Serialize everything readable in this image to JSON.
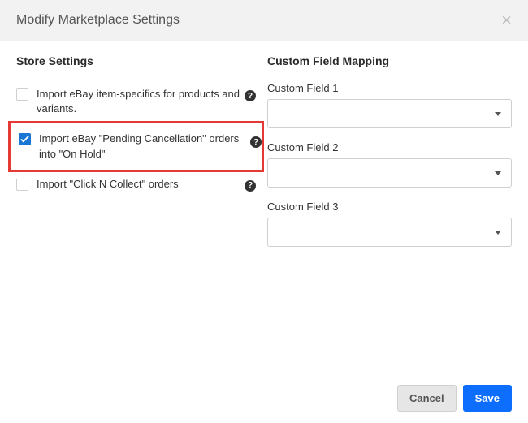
{
  "header": {
    "title": "Modify Marketplace Settings"
  },
  "store_settings": {
    "heading": "Store Settings",
    "items": [
      {
        "label": "Import eBay item-specifics for products and variants.",
        "checked": false,
        "has_help": true
      },
      {
        "label": "Import eBay \"Pending Cancellation\" orders into \"On Hold\"",
        "checked": true,
        "has_help": true,
        "highlighted": true
      },
      {
        "label": "Import \"Click N Collect\" orders",
        "checked": false,
        "has_help": true
      }
    ]
  },
  "custom_field_mapping": {
    "heading": "Custom Field Mapping",
    "fields": [
      {
        "label": "Custom Field 1",
        "value": ""
      },
      {
        "label": "Custom Field 2",
        "value": ""
      },
      {
        "label": "Custom Field 3",
        "value": ""
      }
    ]
  },
  "footer": {
    "cancel": "Cancel",
    "save": "Save"
  }
}
